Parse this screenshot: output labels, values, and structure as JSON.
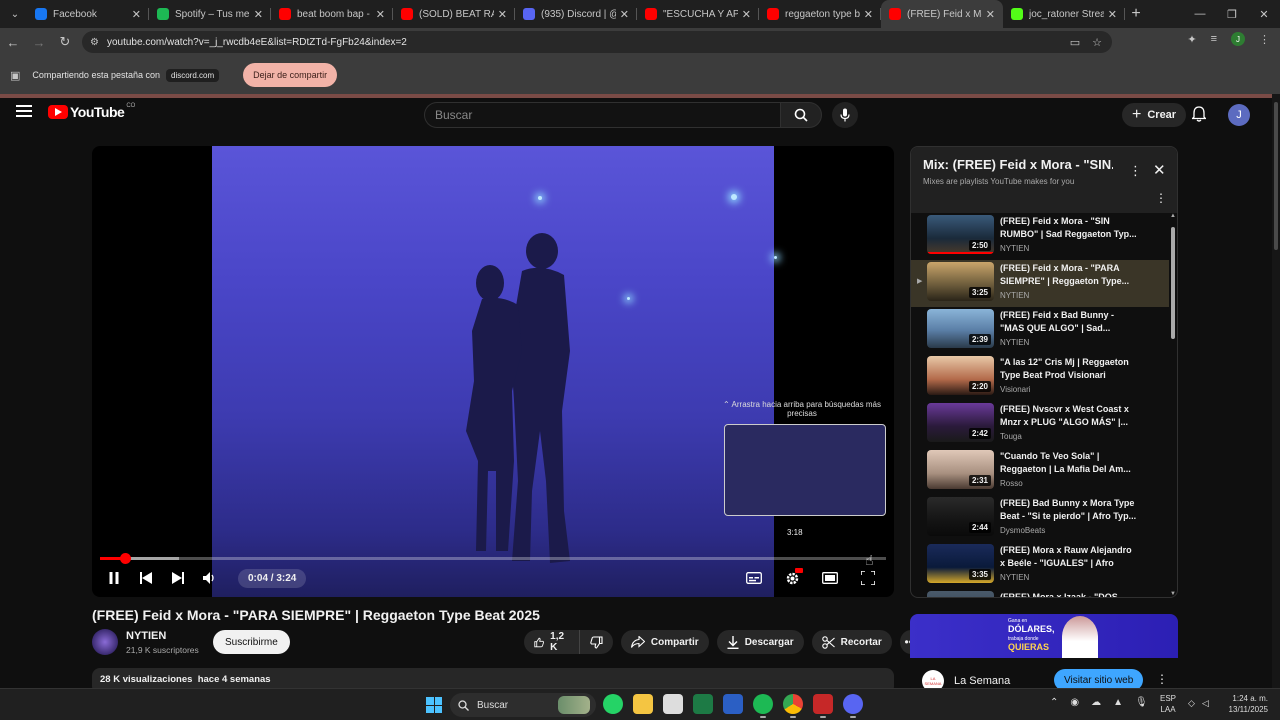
{
  "tabs": [
    {
      "title": "Facebook",
      "color": "#1877f2",
      "icon": "facebook-icon"
    },
    {
      "title": "Spotify – Tus me gus",
      "color": "#1db954",
      "icon": "spotify-icon"
    },
    {
      "title": "beat boom bap - You",
      "color": "#ff0000",
      "icon": "youtube-icon"
    },
    {
      "title": "(SOLD) BEAT RAP BO",
      "color": "#ff0000",
      "icon": "youtube-icon"
    },
    {
      "title": "(935) Discord | @",
      "color": "#5865f2",
      "icon": "discord-icon"
    },
    {
      "title": "\"ESCUCHA Y APREN",
      "color": "#ff0000",
      "icon": "youtube-icon"
    },
    {
      "title": "reggaeton type beat",
      "color": "#ff0000",
      "icon": "youtube-icon"
    },
    {
      "title": "(FREE) Feid x Mor",
      "color": "#ff0000",
      "icon": "youtube-icon",
      "active": true
    },
    {
      "title": "joc_ratoner Stream -",
      "color": "#53fc18",
      "icon": "kick-icon"
    }
  ],
  "browser": {
    "url": "youtube.com/watch?v=_j_rwcdb4eE&list=RDtZTd-FgFb24&index=2",
    "share_text": "Compartiendo esta pestaña con",
    "share_domain": "discord.com",
    "stop_share": "Dejar de compartir",
    "profile_initial": "J"
  },
  "yt": {
    "logo_text": "YouTube",
    "country": "CO",
    "search_placeholder": "Buscar",
    "create_label": "Crear",
    "avatar_initial": "J"
  },
  "player": {
    "hint": "⌃ Arrastra hacia arriba para búsquedas más precisas",
    "preview_time": "3:18",
    "time": "0:04 / 3:24",
    "progress_fraction": 0.02,
    "buffered_fraction": 0.1
  },
  "video": {
    "title": "(FREE) Feid x Mora - \"PARA SIEMPRE\" | Reggaeton Type Beat 2025",
    "channel": "NYTIEN",
    "subscribers": "21,9 K suscriptores",
    "subscribe_label": "Suscribirme",
    "likes": "1,2 K",
    "share_label": "Compartir",
    "download_label": "Descargar",
    "clip_label": "Recortar",
    "views": "28 K visualizaciones",
    "date": "hace 4 semanas"
  },
  "playlist": {
    "title": "Mix: (FREE) Feid x Mora - \"SIN...",
    "subtitle": "Mixes are playlists YouTube makes for you",
    "items": [
      {
        "title": "(FREE) Feid x Mora - \"SIN RUMBO\" | Sad Reggaeton Typ...",
        "channel": "NYTIEN",
        "duration": "2:50",
        "thumb": "linear-gradient(180deg,#3a5a7a,#1a2a3a 60%,#4a3a2a)"
      },
      {
        "title": "(FREE) Feid x Mora - \"PARA SIEMPRE\" | Reggaeton Type...",
        "channel": "NYTIEN",
        "duration": "3:25",
        "thumb": "linear-gradient(180deg,#caa56b,#6a5a3a 60%,#2a2418)",
        "selected": true
      },
      {
        "title": "(FREE) Feid x Bad Bunny - \"MAS QUE ALGO\" | Sad...",
        "channel": "NYTIEN",
        "duration": "2:39",
        "thumb": "linear-gradient(180deg,#8ab4d8,#5a7ea6 55%,#2a3a4a)"
      },
      {
        "title": "\"A las 12\" Cris Mj | Reggaeton Type Beat Prod Visionari",
        "channel": "Visionari",
        "duration": "2:20",
        "thumb": "linear-gradient(180deg,#e8c9a8,#b36a4a 60%,#2a1a14)"
      },
      {
        "title": "(FREE) Nvscvr x West Coast x Mnzr x PLUG \"ALGO MÁS\" |...",
        "channel": "Touga",
        "duration": "2:42",
        "thumb": "linear-gradient(180deg,#6a3a9a,#2a1a3a 60%,#1a1a1a)"
      },
      {
        "title": "\"Cuando Te Veo Sola\" | Reggaeton | La Mafia Del Am...",
        "channel": "Rosso",
        "duration": "2:31",
        "thumb": "linear-gradient(180deg,#e0c8b8,#a89080 60%,#4a3a32)"
      },
      {
        "title": "(FREE) Bad Bunny x Mora Type Beat - \"Si te pierdo\" | Afro Typ...",
        "channel": "DysmoBeats",
        "duration": "2:44",
        "thumb": "linear-gradient(180deg,#2a2a2a,#141414 60%,#0a0a0a)"
      },
      {
        "title": "(FREE) Mora x Rauw Alejandro x Beéle - \"IGUALES\" | Afro Typ...",
        "channel": "NYTIEN",
        "duration": "3:35",
        "thumb": "linear-gradient(180deg,#1a2a5a,#0a1a3a 60%,#d4a82a)"
      },
      {
        "title": "(FREE) Mora x Izaak - \"DOS",
        "channel": "",
        "duration": "",
        "thumb": "linear-gradient(180deg,#4a5a6a,#2a3a4a)"
      }
    ]
  },
  "ad": {
    "banner_l1": "Gana en",
    "banner_l2": "DÓLARES,",
    "banner_l3": "trabaja donde",
    "banner_l4": "QUIERAS",
    "logo_text": "LA SEMANA",
    "advertiser": "La Semana",
    "cta": "Visitar sitio web"
  },
  "taskbar": {
    "search": "Buscar",
    "lang1": "ESP",
    "lang2": "LAA",
    "time": "1:24 a. m.",
    "date": "13/11/2025"
  }
}
